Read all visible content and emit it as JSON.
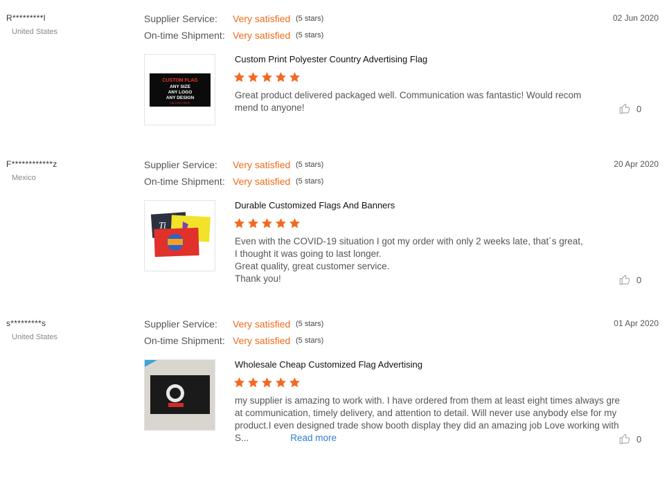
{
  "reviews": [
    {
      "reviewer": "R*********l",
      "country": "United States",
      "date": "02 Jun 2020",
      "supplier_service_label": "Supplier Service:",
      "supplier_service_value": "Very satisfied",
      "supplier_service_stars": "(5 stars)",
      "shipment_label": "On-time Shipment:",
      "shipment_value": "Very satisfied",
      "shipment_stars": "(5 stars)",
      "product_title": "Custom Print Polyester Country Advertising Flag",
      "rating": 5,
      "comment": "Great product delivered packaged well.  Communication was fantastic!  Would recommend to anyone!",
      "likes": "0",
      "flag_text": [
        "CUSTOM FLAG",
        "ANY SIZE",
        "ANY LOGO",
        "ANY DESIGN",
        "FACTORY PRICE"
      ]
    },
    {
      "reviewer": "F************z",
      "country": "Mexico",
      "date": "20 Apr 2020",
      "supplier_service_label": "Supplier Service:",
      "supplier_service_value": "Very satisfied",
      "supplier_service_stars": "(5 stars)",
      "shipment_label": "On-time Shipment:",
      "shipment_value": "Very satisfied",
      "shipment_stars": "(5 stars)",
      "product_title": "Durable Customized Flags And Banners",
      "rating": 5,
      "comment": "Even with the COVID-19 situation I got my order with only 2 weeks late, that´s great, I thought it was going to last longer.\nGreat quality, great customer service.\nThank you!",
      "likes": "0"
    },
    {
      "reviewer": "s*********s",
      "country": "United States",
      "date": "01 Apr 2020",
      "supplier_service_label": "Supplier Service:",
      "supplier_service_value": "Very satisfied",
      "supplier_service_stars": "(5 stars)",
      "shipment_label": "On-time Shipment:",
      "shipment_value": "Very satisfied",
      "shipment_stars": "(5 stars)",
      "product_title": "Wholesale Cheap Customized Flag Advertising",
      "rating": 5,
      "comment": "my supplier is amazing to work with. I have ordered from them at least eight times always great communication, timely delivery, and attention to detail. Will never use anybody else for my product.I even designed trade show booth display they did an amazing job Love working with S...",
      "read_more": "Read more",
      "likes": "0"
    }
  ],
  "colors": {
    "accent_orange": "#f06a1d",
    "link_blue": "#2f7fd0",
    "star_orange": "#f26a21"
  },
  "icons": {
    "star": "star-icon",
    "like": "thumbs-up-icon"
  }
}
